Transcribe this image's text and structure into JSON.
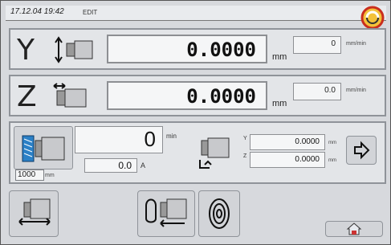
{
  "topbar": {
    "time": "17.12.04 19:42",
    "mode": "EDIT"
  },
  "y_axis": {
    "letter": "Y",
    "value": "0.0000",
    "unit": "mm",
    "feed": "0",
    "feed_unit": "mm/min"
  },
  "z_axis": {
    "letter": "Z",
    "value": "0.0000",
    "unit": "mm",
    "feed": "0.0",
    "feed_unit": "mm/min"
  },
  "spindle": {
    "rpm": "0",
    "rpm_unit": "min",
    "current": "0.0",
    "current_unit": "A",
    "label": "1000",
    "label_unit": "mm"
  },
  "tool": {
    "y_label": "Y",
    "y_value": "0.0000",
    "y_unit": "mm",
    "z_label": "Z",
    "z_value": "0.0000",
    "z_unit": "mm"
  },
  "icons": [
    "spindle-icon",
    "arrow-right-icon",
    "home-icon",
    "wheel-icon",
    "tool-change-icon"
  ],
  "colors": {
    "panel_bg": "#d7d9dd",
    "box_bg": "#f5f6f7",
    "border": "#8f9399"
  }
}
